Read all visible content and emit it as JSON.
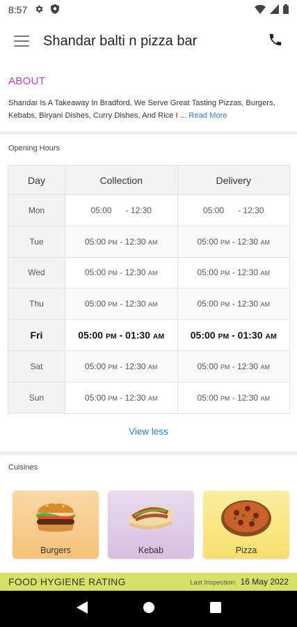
{
  "status_bar": {
    "time": "8:57"
  },
  "app_bar": {
    "title": "Shandar balti n pizza bar"
  },
  "about": {
    "heading": "ABOUT",
    "text": "Shandar Is A Takeaway In Bradford, We Serve Great Tasting Pizzas, Burgers, Kebabs, Biryani Dishes, Curry Dishes, And Rice I ...",
    "read_more": "Read More"
  },
  "opening_hours": {
    "label": "Opening Hours",
    "headers": {
      "day": "Day",
      "collection": "Collection",
      "delivery": "Delivery"
    },
    "rows": [
      {
        "day": "Mon",
        "c_open": "05:00",
        "c_open_p": "",
        "c_close": "12:30",
        "c_close_p": "",
        "d_open": "05:00",
        "d_open_p": "",
        "d_close": "12:30",
        "d_close_p": ""
      },
      {
        "day": "Tue",
        "c_open": "05:00",
        "c_open_p": "PM",
        "c_close": "12:30",
        "c_close_p": "AM",
        "d_open": "05:00",
        "d_open_p": "PM",
        "d_close": "12:30",
        "d_close_p": "AM"
      },
      {
        "day": "Wed",
        "c_open": "05:00",
        "c_open_p": "PM",
        "c_close": "12:30",
        "c_close_p": "AM",
        "d_open": "05:00",
        "d_open_p": "PM",
        "d_close": "12:30",
        "d_close_p": "AM"
      },
      {
        "day": "Thu",
        "c_open": "05:00",
        "c_open_p": "PM",
        "c_close": "12:30",
        "c_close_p": "AM",
        "d_open": "05:00",
        "d_open_p": "PM",
        "d_close": "12:30",
        "d_close_p": "AM"
      },
      {
        "day": "Fri",
        "c_open": "05:00",
        "c_open_p": "PM",
        "c_close": "01:30",
        "c_close_p": "AM",
        "d_open": "05:00",
        "d_open_p": "PM",
        "d_close": "01:30",
        "d_close_p": "AM"
      },
      {
        "day": "Sat",
        "c_open": "05:00",
        "c_open_p": "PM",
        "c_close": "12:30",
        "c_close_p": "AM",
        "d_open": "05:00",
        "d_open_p": "PM",
        "d_close": "12:30",
        "d_close_p": "AM"
      },
      {
        "day": "Sun",
        "c_open": "05:00",
        "c_open_p": "PM",
        "c_close": "12:30",
        "c_close_p": "AM",
        "d_open": "05:00",
        "d_open_p": "PM",
        "d_close": "12:30",
        "d_close_p": "AM"
      }
    ],
    "view_less": "View less"
  },
  "cuisines": {
    "label": "Cuisines",
    "items": [
      {
        "label": "Burgers",
        "icon": "burger-icon"
      },
      {
        "label": "Kebab",
        "icon": "kebab-icon"
      },
      {
        "label": "Pizza",
        "icon": "pizza-icon"
      }
    ]
  },
  "hygiene": {
    "title": "FOOD HYGIENE RATING",
    "last_inspection_label": "Last Inspection:",
    "last_inspection_date": "16 May 2022"
  },
  "colors": {
    "accent": "#b03fc4",
    "link": "#2c7cd6",
    "hygiene_bar": "#d9e06a"
  }
}
